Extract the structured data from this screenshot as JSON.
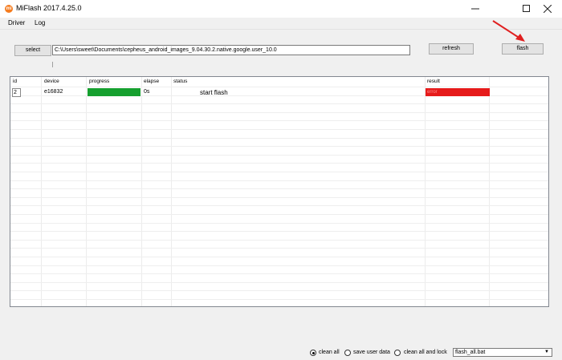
{
  "window": {
    "title": "MiFlash 2017.4.25.0",
    "icon_letter": "mi",
    "accent_color": "#f57c1f"
  },
  "menu": {
    "driver": "Driver",
    "log": "Log"
  },
  "toolbar": {
    "select_label": "select",
    "path_value": "C:\\Users\\sweet\\Documents\\cepheus_android_images_9.04.30.2.native.google.user_10.0",
    "refresh_label": "refresh",
    "flash_label": "flash"
  },
  "grid": {
    "columns": [
      "id",
      "device",
      "progress",
      "elapse",
      "status",
      "result"
    ],
    "rows": [
      {
        "id": "2",
        "device": "e16832",
        "progress": 1.0,
        "elapse": "0s",
        "status": "start flash",
        "result": "error",
        "progress_color": "#16a02f",
        "result_color": "#e61b1b"
      }
    ]
  },
  "options": {
    "clean_all": "clean all",
    "save_user_data": "save user data",
    "clean_all_and_lock": "clean all and lock",
    "selected": "clean_all",
    "script": "flash_all.bat"
  },
  "annotation": {
    "arrow_color": "#e02020",
    "icon": "red-arrow-icon"
  }
}
